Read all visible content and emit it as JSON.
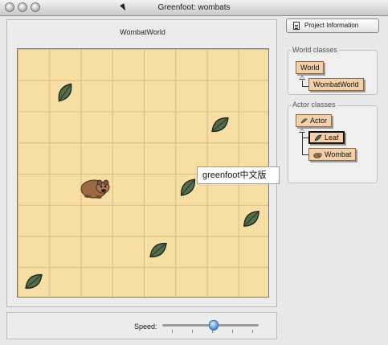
{
  "window": {
    "title": "Greenfoot: wombats"
  },
  "world": {
    "name": "WombatWorld",
    "grid_columns": 8,
    "grid_rows": 8,
    "background_color": "#f7dfa6",
    "actors": [
      {
        "type": "leaf",
        "icon": "leaf-icon"
      },
      {
        "type": "leaf",
        "icon": "leaf-icon"
      },
      {
        "type": "leaf",
        "icon": "leaf-icon"
      },
      {
        "type": "leaf",
        "icon": "leaf-icon"
      },
      {
        "type": "leaf",
        "icon": "leaf-icon"
      },
      {
        "type": "leaf",
        "icon": "leaf-icon"
      },
      {
        "type": "wombat",
        "icon": "wombat-icon"
      }
    ]
  },
  "tooltip": {
    "text": "greenfoot中文版"
  },
  "controls": {
    "speed_label": "Speed:",
    "speed_level": 0.53
  },
  "sidebar": {
    "project_info_label": "Project Information",
    "world_classes_label": "World classes",
    "world_classes": [
      {
        "name": "World"
      },
      {
        "name": "WombatWorld"
      }
    ],
    "actor_classes_label": "Actor classes",
    "actor_classes": [
      {
        "name": "Actor"
      },
      {
        "name": "Leaf"
      },
      {
        "name": "Wombat"
      }
    ]
  },
  "colors": {
    "class_box": "#f3cfaa",
    "grid_line": "#d9bd82",
    "slider_thumb": "#5a9be0"
  }
}
